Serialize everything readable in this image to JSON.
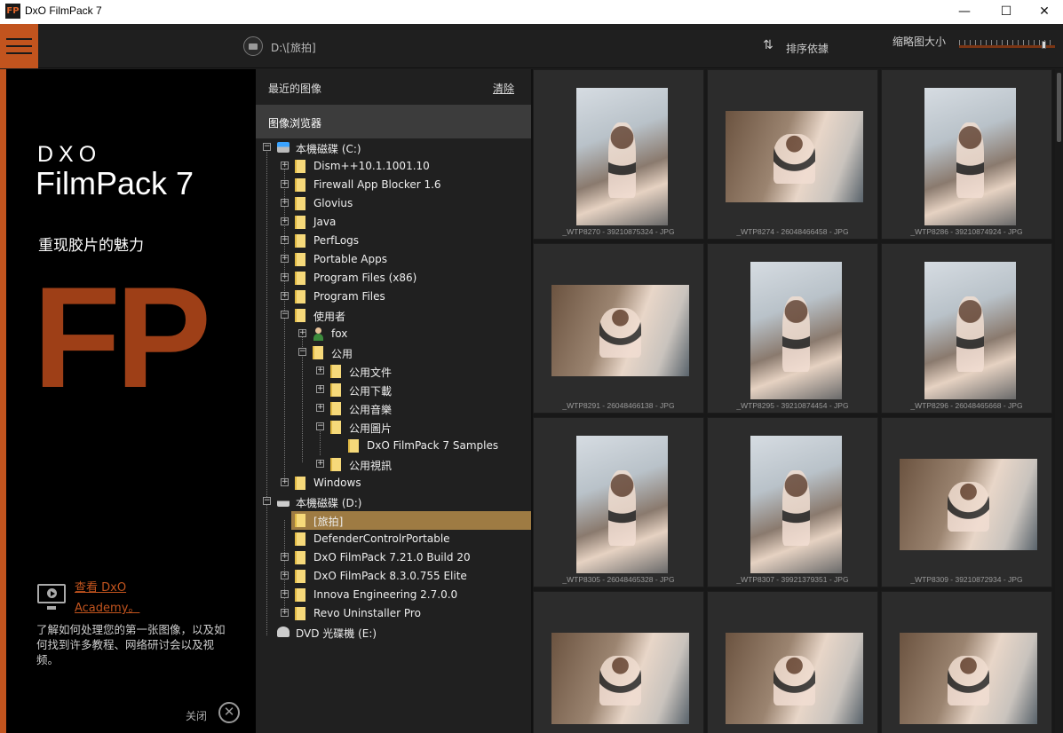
{
  "window": {
    "app_icon_text": "FP",
    "title": "DxO FilmPack 7",
    "minimize": "—",
    "maximize": "☐",
    "close": "✕"
  },
  "toolbar": {
    "menu_icon": "hamburger-icon",
    "path": "D:\\[旅拍]",
    "sort_icon_glyph": "⇅",
    "sort_label": "排序依據",
    "thumb_size_label": "缩略图大小",
    "thumb_size_level": 0.9
  },
  "promo": {
    "brand": "DXO",
    "product": "FilmPack 7",
    "tagline": "重现胶片的魅力",
    "big_logo": "FP",
    "link_line1": "查看 DxO",
    "link_line2": "Academy。",
    "description": "了解如何处理您的第一张图像，以及如何找到许多教程、网络研讨会以及视频。",
    "close_label": "关闭",
    "close_glyph": "✕",
    "accent_color": "#c2541e"
  },
  "browser": {
    "recent_label": "最近的图像",
    "clear_label": "清除",
    "header": "图像浏览器",
    "tree": [
      {
        "label": "本機磁碟 (C:)",
        "icon": "drive-c-icon",
        "expander": "−"
      },
      {
        "label": "Dism++10.1.1001.10",
        "icon": "folder-icon",
        "expander": "+"
      },
      {
        "label": "Firewall App Blocker 1.6",
        "icon": "folder-icon",
        "expander": "+"
      },
      {
        "label": "Glovius",
        "icon": "folder-icon",
        "expander": "+"
      },
      {
        "label": "Java",
        "icon": "folder-icon",
        "expander": "+"
      },
      {
        "label": "PerfLogs",
        "icon": "folder-icon",
        "expander": "+"
      },
      {
        "label": "Portable Apps",
        "icon": "folder-icon",
        "expander": "+"
      },
      {
        "label": "Program Files (x86)",
        "icon": "folder-icon",
        "expander": "+"
      },
      {
        "label": "Program Files",
        "icon": "folder-icon",
        "expander": "+"
      },
      {
        "label": "使用者",
        "icon": "folder-icon",
        "expander": "−"
      },
      {
        "label": "fox",
        "icon": "user-icon",
        "expander": "+"
      },
      {
        "label": "公用",
        "icon": "folder-icon",
        "expander": "−"
      },
      {
        "label": "公用文件",
        "icon": "folder-icon",
        "expander": "+"
      },
      {
        "label": "公用下載",
        "icon": "folder-icon",
        "expander": "+"
      },
      {
        "label": "公用音樂",
        "icon": "folder-icon",
        "expander": "+"
      },
      {
        "label": "公用圖片",
        "icon": "folder-icon",
        "expander": "−"
      },
      {
        "label": "DxO FilmPack 7 Samples",
        "icon": "folder-icon",
        "expander": ""
      },
      {
        "label": "公用視訊",
        "icon": "folder-icon",
        "expander": "+"
      },
      {
        "label": "Windows",
        "icon": "folder-icon",
        "expander": "+"
      },
      {
        "label": "本機磁碟 (D:)",
        "icon": "drive-d-icon",
        "expander": "−"
      },
      {
        "label": "[旅拍]",
        "icon": "folder-icon",
        "expander": "",
        "selected": true
      },
      {
        "label": "DefenderControlrPortable",
        "icon": "folder-icon",
        "expander": ""
      },
      {
        "label": "DxO FilmPack 7.21.0 Build 20",
        "icon": "folder-icon",
        "expander": "+"
      },
      {
        "label": "DxO FilmPack 8.3.0.755 Elite",
        "icon": "folder-icon",
        "expander": "+"
      },
      {
        "label": "Innova Engineering 2.7.0.0",
        "icon": "folder-icon",
        "expander": "+"
      },
      {
        "label": "Revo Uninstaller Pro",
        "icon": "folder-icon",
        "expander": "+"
      },
      {
        "label": "DVD 光碟機 (E:)",
        "icon": "dvd-drive-icon",
        "expander": ""
      }
    ]
  },
  "thumbnails": [
    {
      "caption": "_WTP8270 - 39210875324 - JPG",
      "orientation": "portrait"
    },
    {
      "caption": "_WTP8274 - 26048466458 - JPG",
      "orientation": "landscape"
    },
    {
      "caption": "_WTP8286 - 39210874924 - JPG",
      "orientation": "portrait"
    },
    {
      "caption": "_WTP8291 - 26048466138 - JPG",
      "orientation": "landscape"
    },
    {
      "caption": "_WTP8295 - 39210874454 - JPG",
      "orientation": "portrait"
    },
    {
      "caption": "_WTP8296 - 26048465668 - JPG",
      "orientation": "portrait"
    },
    {
      "caption": "_WTP8305 - 26048465328 - JPG",
      "orientation": "portrait"
    },
    {
      "caption": "_WTP8307 - 39921379351 - JPG",
      "orientation": "portrait"
    },
    {
      "caption": "_WTP8309 - 39210872934 - JPG",
      "orientation": "landscape"
    },
    {
      "caption": "",
      "orientation": "landscape"
    },
    {
      "caption": "",
      "orientation": "landscape"
    },
    {
      "caption": "",
      "orientation": "landscape"
    }
  ]
}
